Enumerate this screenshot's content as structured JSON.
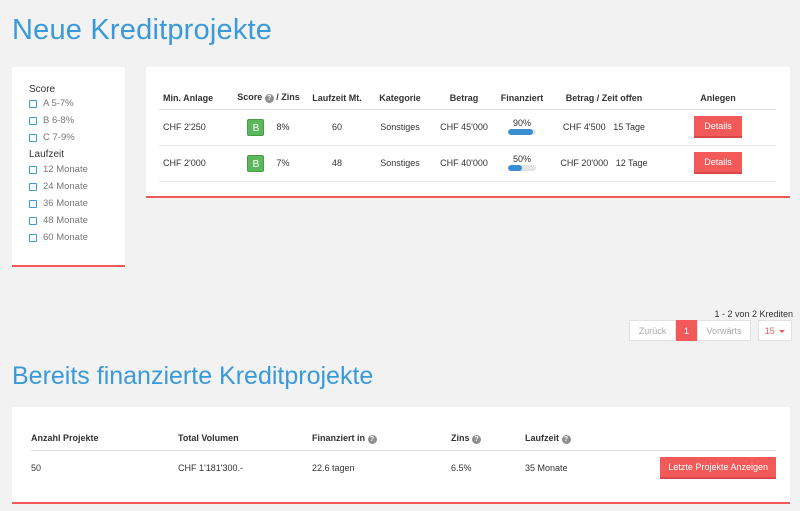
{
  "headings": {
    "new": "Neue Kreditprojekte",
    "financed": "Bereits finanzierte Kreditprojekte"
  },
  "filters": {
    "score_title": "Score",
    "score_options": [
      "A 5-7%",
      "B 6-8%",
      "C 7-9%"
    ],
    "term_title": "Laufzeit",
    "term_options": [
      "12 Monate",
      "24 Monate",
      "36 Monate",
      "48 Monate",
      "60 Monate"
    ]
  },
  "credits": {
    "headers": {
      "min_invest": "Min. Anlage",
      "score": "Score",
      "rate": "/ Zins",
      "term": "Laufzeit Mt.",
      "category": "Kategorie",
      "amount": "Betrag",
      "funded": "Finanziert",
      "open": "Betrag / Zeit offen",
      "invest": "Anlegen"
    },
    "rows": [
      {
        "min_invest": "CHF 2'250",
        "score": "B",
        "rate": "8%",
        "term": "60",
        "category": "Sonstiges",
        "amount": "CHF 45'000",
        "funded": "90%",
        "funded_fraction": 0.9,
        "open_amount": "CHF 4'500",
        "open_time": "15 Tage",
        "button": "Details"
      },
      {
        "min_invest": "CHF 2'000",
        "score": "B",
        "rate": "7%",
        "term": "48",
        "category": "Sonstiges",
        "amount": "CHF 40'000",
        "funded": "50%",
        "funded_fraction": 0.5,
        "open_amount": "CHF 20'000",
        "open_time": "12 Tage",
        "button": "Details"
      }
    ]
  },
  "pagination": {
    "count_text": "1 - 2 von 2 Krediten",
    "prev": "Zurück",
    "current": "1",
    "next": "Vorwärts",
    "per_page": "15"
  },
  "financed": {
    "headers": {
      "count": "Anzahl Projekte",
      "volume": "Total Volumen",
      "financed_in": "Finanziert in",
      "rate": "Zins",
      "term": "Laufzeit"
    },
    "row": {
      "count": "50",
      "volume": "CHF 1'181'300.-",
      "financed_in": "22.6 tagen",
      "rate": "6.5%",
      "term": "35 Monate"
    },
    "button": "Letzte Projekte Anzeigen"
  },
  "colors": {
    "accent_blue": "#3a9ad9",
    "accent_red": "#f25a5a",
    "score_green": "#5cb85c"
  }
}
